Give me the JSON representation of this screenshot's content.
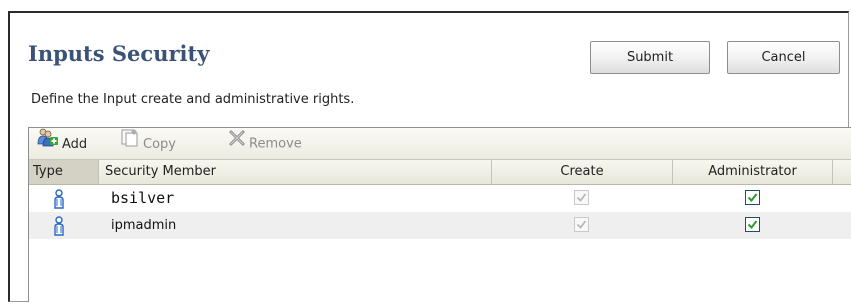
{
  "header": {
    "title": "Inputs Security",
    "subtitle": "Define the Input create and administrative rights.",
    "submit_label": "Submit",
    "cancel_label": "Cancel"
  },
  "toolbar": {
    "add_label": "Add",
    "copy_label": "Copy",
    "remove_label": "Remove"
  },
  "table": {
    "columns": [
      "Type",
      "Security Member",
      "Create",
      "Administrator"
    ],
    "rows": [
      {
        "type_icon": "user-icon",
        "member": "bsilver",
        "create": true,
        "create_enabled": false,
        "administrator": true
      },
      {
        "type_icon": "user-icon",
        "member": "ipmadmin",
        "create": true,
        "create_enabled": false,
        "administrator": true
      }
    ]
  },
  "colors": {
    "title": "#3a5276",
    "check_enabled": "#2e9a2e",
    "check_disabled": "#b8b8b8"
  }
}
